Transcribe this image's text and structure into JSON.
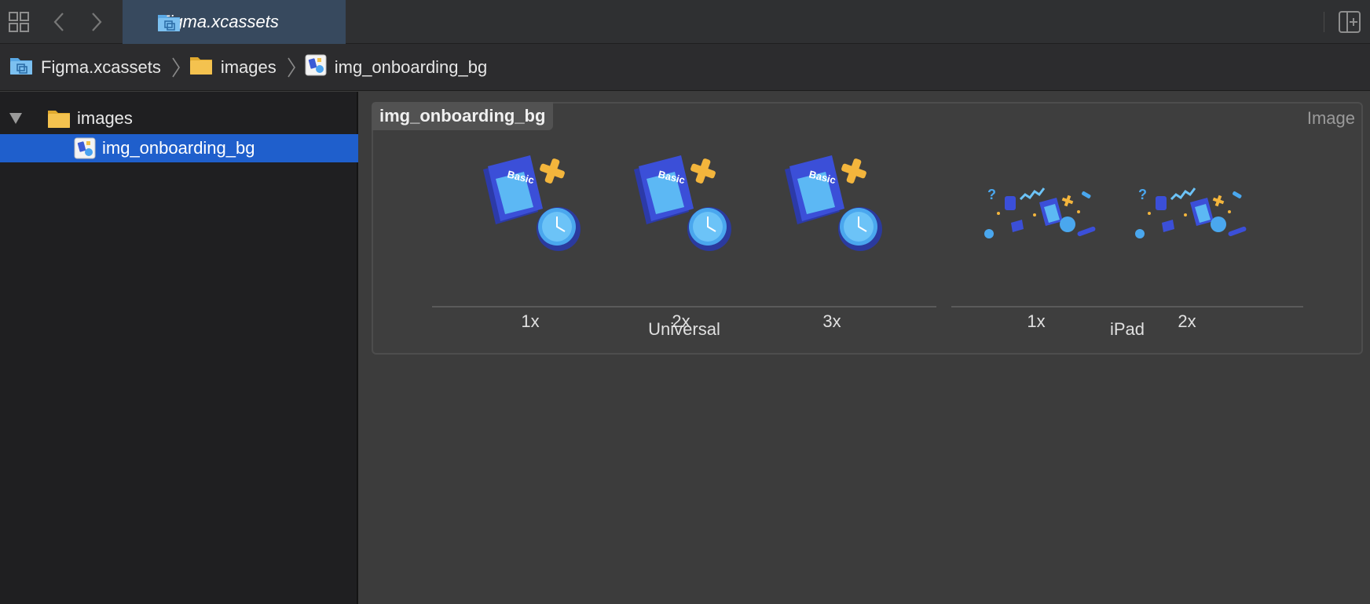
{
  "window": {
    "tab_title": "Figma.xcassets"
  },
  "breadcrumb": {
    "items": [
      {
        "label": "Figma.xcassets",
        "icon": "asset-catalog-icon"
      },
      {
        "label": "images",
        "icon": "folder-icon"
      },
      {
        "label": "img_onboarding_bg",
        "icon": "image-set-icon"
      }
    ]
  },
  "sidebar": {
    "items": [
      {
        "label": "images",
        "icon": "folder-icon",
        "expanded": true
      },
      {
        "label": "img_onboarding_bg",
        "icon": "image-set-icon",
        "selected": true
      }
    ]
  },
  "asset": {
    "name": "img_onboarding_bg",
    "kind": "Image",
    "groups": [
      {
        "label": "Universal",
        "slots": [
          "1x",
          "2x",
          "3x"
        ]
      },
      {
        "label": "iPad",
        "slots": [
          "1x",
          "2x"
        ]
      }
    ]
  },
  "colors": {
    "accent": "#1f5fcc",
    "folder": "#f2c14e",
    "tab": "#37495e"
  }
}
